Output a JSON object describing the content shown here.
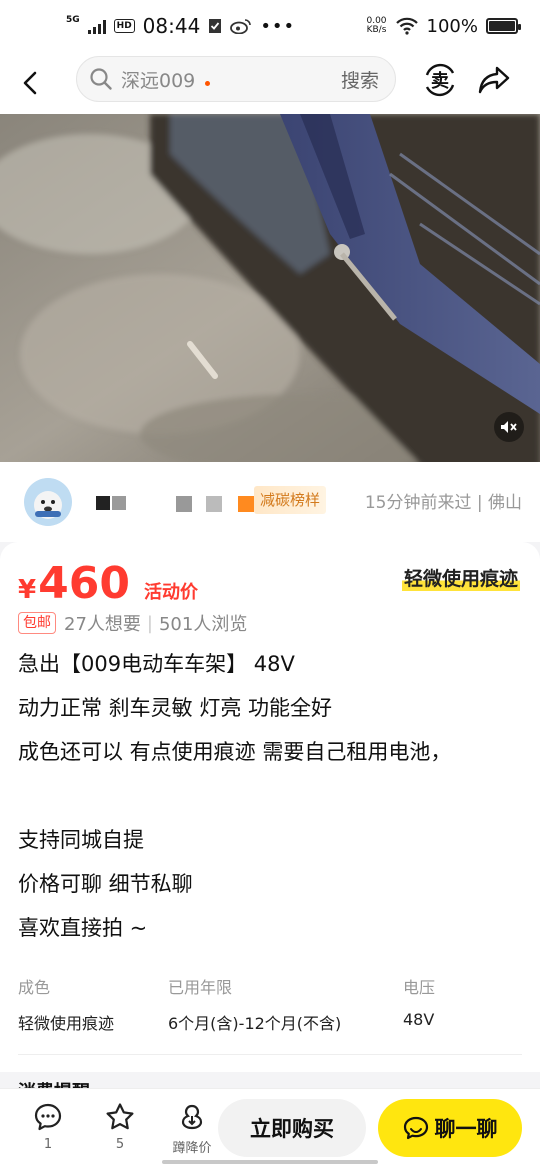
{
  "status_bar": {
    "network": "5G",
    "hd": "HD",
    "time": "08:44",
    "speed_value": "0.00",
    "speed_unit": "KB/s",
    "battery": "100%",
    "battery_level": 1.0
  },
  "header": {
    "search_query": "深远009",
    "search_button": "搜索",
    "sell_icon_label": "卖"
  },
  "seller": {
    "badge": "减碳榜样",
    "last_seen": "15分钟前来过 | 佛山"
  },
  "listing": {
    "currency": "¥",
    "price": "460",
    "promo_label": "活动价",
    "condition_tag": "轻微使用痕迹",
    "shipping_tag": "包邮",
    "wants": "27人想要",
    "views": "501人浏览",
    "description": [
      "急出【009电动车车架】 48V",
      "动力正常 刹车灵敏 灯亮 功能全好",
      "成色还可以 有点使用痕迹 需要自己租用电池，",
      "",
      "支持同城自提",
      "价格可聊 细节私聊",
      "喜欢直接拍 ~"
    ],
    "attributes": [
      {
        "key": "成色",
        "value": "轻微使用痕迹"
      },
      {
        "key": "已用年限",
        "value": "6个月(含)-12个月(不含)"
      },
      {
        "key": "电压",
        "value": "48V"
      }
    ],
    "more_title": "消费提醒"
  },
  "bottom_bar": {
    "comments_count": "1",
    "favorites_count": "5",
    "price_drop_label": "蹲降价",
    "buy_label": "立即购买",
    "chat_label": "聊一聊"
  }
}
